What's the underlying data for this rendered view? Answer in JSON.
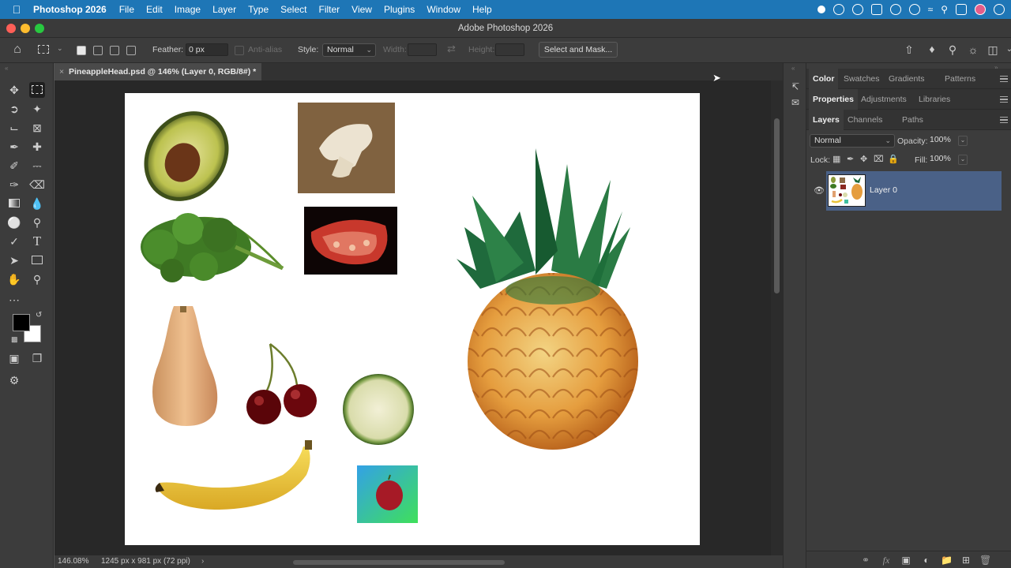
{
  "menubar": {
    "app": "Photoshop 2026",
    "items": [
      "File",
      "Edit",
      "Image",
      "Layer",
      "Type",
      "Select",
      "Filter",
      "View",
      "Plugins",
      "Window",
      "Help"
    ],
    "color": "#1e76b6"
  },
  "window": {
    "title": "Adobe Photoshop 2026"
  },
  "options": {
    "feather_label": "Feather:",
    "feather_value": "0 px",
    "antialias_label": "Anti-alias",
    "style_label": "Style:",
    "style_value": "Normal",
    "width_label": "Width:",
    "height_label": "Height:",
    "select_mask_label": "Select and Mask..."
  },
  "document": {
    "tab_title": "PineappleHead.psd @ 146% (Layer 0, RGB/8#) *",
    "zoom": "146.08%",
    "dimensions": "1245 px x 981 px (72 ppi)"
  },
  "panels": {
    "group1_tabs": [
      "Color",
      "Swatches",
      "Gradients",
      "Patterns"
    ],
    "group2_tabs": [
      "Properties",
      "Adjustments",
      "Libraries"
    ],
    "group3_tabs": [
      "Layers",
      "Channels",
      "Paths"
    ]
  },
  "layers": {
    "blend_mode": "Normal",
    "opacity_label": "Opacity:",
    "opacity_value": "100%",
    "lock_label": "Lock:",
    "fill_label": "Fill:",
    "fill_value": "100%",
    "items": [
      {
        "name": "Layer 0"
      }
    ],
    "selected_color": "#4a6187",
    "fx_label": "fx"
  }
}
